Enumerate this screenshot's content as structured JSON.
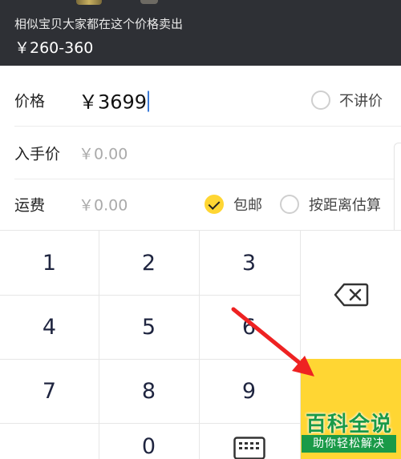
{
  "banner": {
    "hint": "相似宝贝大家都在这个价格卖出",
    "range": "￥260-360"
  },
  "form": {
    "price": {
      "label": "价格",
      "value": "￥3699",
      "option": "不讲价"
    },
    "purchase": {
      "label": "入手价",
      "placeholder": "￥0.00"
    },
    "shipping": {
      "label": "运费",
      "placeholder": "￥0.00",
      "options": [
        {
          "label": "包邮",
          "checked": true
        },
        {
          "label": "按距离估算",
          "checked": false
        }
      ]
    }
  },
  "keypad": {
    "keys": [
      "1",
      "2",
      "3",
      "4",
      "5",
      "6",
      "7",
      "8",
      "9",
      "0"
    ],
    "backspace_icon": "backspace-icon",
    "keyboard_icon": "keyboard-icon"
  },
  "colors": {
    "accent": "#ffd633",
    "banner": "#2e3035",
    "arrow": "#ee2222",
    "watermark": "#1a9a48"
  },
  "watermark": {
    "title": "百科全说",
    "subtitle": "助你轻松解决"
  }
}
